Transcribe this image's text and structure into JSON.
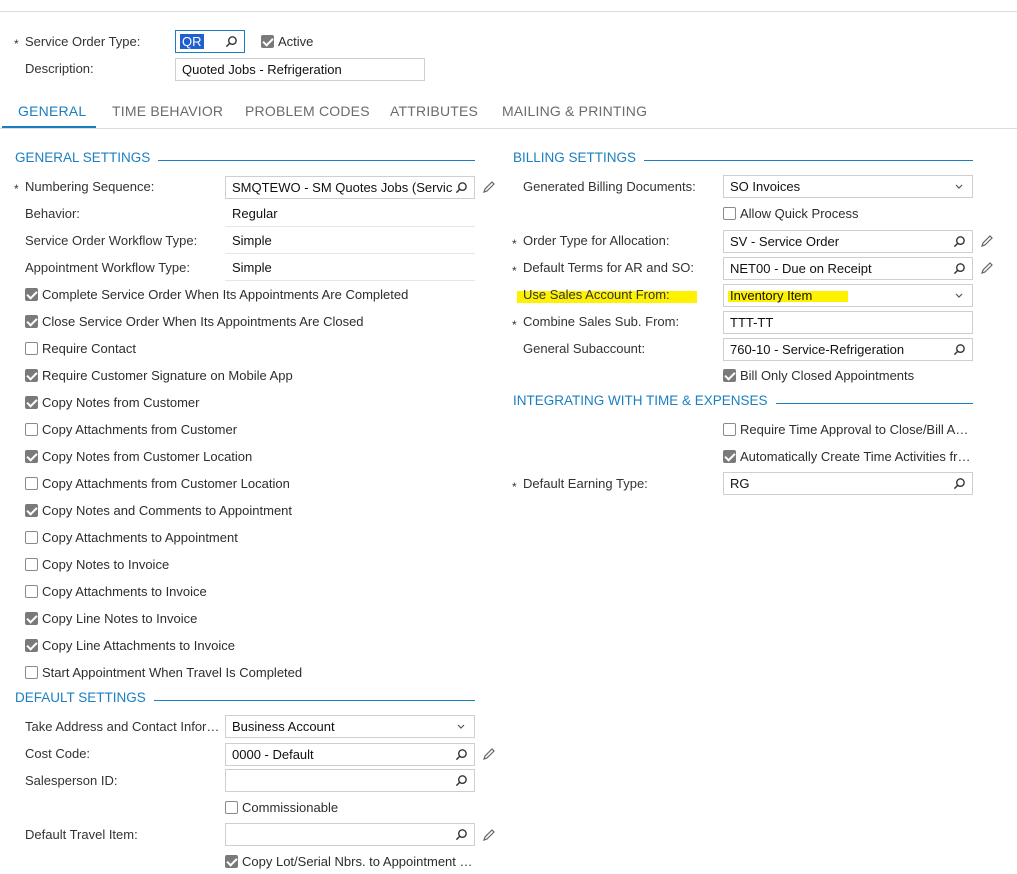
{
  "header": {
    "service_order_type_label": "Service Order Type:",
    "service_order_type_value": "QR",
    "active_label": "Active",
    "active_checked": true,
    "description_label": "Description:",
    "description_value": "Quoted Jobs - Refrigeration"
  },
  "tabs": [
    "GENERAL",
    "TIME BEHAVIOR",
    "PROBLEM CODES",
    "ATTRIBUTES",
    "MAILING & PRINTING"
  ],
  "general_settings": {
    "title": "GENERAL SETTINGS",
    "numbering_label": "Numbering Sequence:",
    "numbering_value": "SMQTEWO - SM Quotes Jobs (Servic",
    "behavior_label": "Behavior:",
    "behavior_value": "Regular",
    "so_workflow_label": "Service Order Workflow Type:",
    "so_workflow_value": "Simple",
    "appt_workflow_label": "Appointment Workflow Type:",
    "appt_workflow_value": "Simple",
    "checkboxes": [
      {
        "label": "Complete Service Order When Its Appointments Are Completed",
        "checked": true
      },
      {
        "label": "Close Service Order When Its Appointments Are Closed",
        "checked": true
      },
      {
        "label": "Require Contact",
        "checked": false
      },
      {
        "label": "Require Customer Signature on Mobile App",
        "checked": true
      },
      {
        "label": "Copy Notes from Customer",
        "checked": true
      },
      {
        "label": "Copy Attachments from Customer",
        "checked": false
      },
      {
        "label": "Copy Notes from Customer Location",
        "checked": true
      },
      {
        "label": "Copy Attachments from Customer Location",
        "checked": false
      },
      {
        "label": "Copy Notes and Comments to Appointment",
        "checked": true
      },
      {
        "label": "Copy Attachments to Appointment",
        "checked": false
      },
      {
        "label": "Copy Notes to Invoice",
        "checked": false
      },
      {
        "label": "Copy Attachments to Invoice",
        "checked": false
      },
      {
        "label": "Copy Line Notes to Invoice",
        "checked": true
      },
      {
        "label": "Copy Line Attachments to Invoice",
        "checked": true
      },
      {
        "label": "Start Appointment When Travel Is Completed",
        "checked": false
      }
    ]
  },
  "default_settings": {
    "title": "DEFAULT SETTINGS",
    "take_address_label": "Take Address and Contact Infor…",
    "take_address_value": "Business Account",
    "cost_code_label": "Cost Code:",
    "cost_code_value": "0000 - Default",
    "salesperson_label": "Salesperson ID:",
    "salesperson_value": "",
    "commissionable_label": "Commissionable",
    "commissionable_checked": false,
    "travel_item_label": "Default Travel Item:",
    "travel_item_value": "",
    "copy_lot_label": "Copy Lot/Serial Nbrs. to Appointment …",
    "copy_lot_checked": true
  },
  "billing_settings": {
    "title": "BILLING SETTINGS",
    "gen_docs_label": "Generated Billing Documents:",
    "gen_docs_value": "SO Invoices",
    "allow_quick_label": "Allow Quick Process",
    "allow_quick_checked": false,
    "order_type_label": "Order Type for Allocation:",
    "order_type_value": "SV - Service Order",
    "terms_label": "Default Terms for AR and SO:",
    "terms_value": "NET00 - Due on Receipt",
    "use_sales_label": "Use Sales Account From:",
    "use_sales_value": "Inventory Item",
    "combine_label": "Combine Sales Sub. From:",
    "combine_value": "TTT-TT",
    "gen_sub_label": "General Subaccount:",
    "gen_sub_value": "760-10 - Service-Refrigeration",
    "bill_closed_label": "Bill Only Closed Appointments",
    "bill_closed_checked": true
  },
  "integrating": {
    "title": "INTEGRATING WITH TIME & EXPENSES",
    "require_approval_label": "Require Time Approval to Close/Bill A…",
    "require_approval_checked": false,
    "auto_create_label": "Automatically Create Time Activities fr…",
    "auto_create_checked": true,
    "earning_type_label": "Default Earning Type:",
    "earning_type_value": "RG"
  },
  "colors": {
    "accent": "#1a7fc1",
    "highlight": "#fff200",
    "checkbox_checked": "#7a7a7a"
  }
}
